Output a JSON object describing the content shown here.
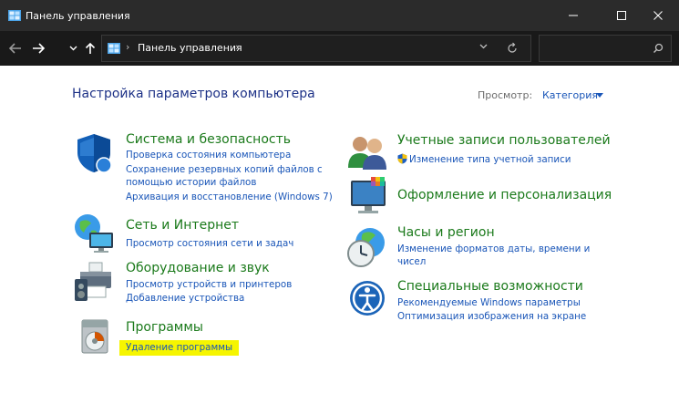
{
  "window": {
    "title": "Панель управления",
    "minimize_glyph": "—",
    "maximize_glyph": "☐",
    "close_glyph": "✕"
  },
  "navbar": {
    "back_glyph": "←",
    "forward_glyph": "→",
    "recent_glyph": "⌄",
    "up_glyph": "↑",
    "breadcrumb_sep": "›",
    "breadcrumb": "Панель управления",
    "dropdown_glyph": "⌄",
    "refresh_glyph": "↻",
    "search_placeholder": "",
    "search_glyph": "⌕"
  },
  "content": {
    "heading": "Настройка параметров компьютера",
    "view_label": "Просмотр:",
    "view_value": "Категория"
  },
  "categories": [
    {
      "icon": "shield-icon",
      "title": "Система и безопасность",
      "links": [
        "Проверка состояния компьютера",
        "Сохранение резервных копий файлов с",
        "помощью истории файлов",
        "Архивация и восстановление (Windows 7)"
      ]
    },
    {
      "icon": "network-globe-icon",
      "title": "Сеть и Интернет",
      "links": [
        "Просмотр состояния сети и задач"
      ]
    },
    {
      "icon": "printer-speaker-icon",
      "title": "Оборудование и звук",
      "links": [
        "Просмотр устройств и принтеров",
        "Добавление устройства"
      ]
    },
    {
      "icon": "programs-disc-icon",
      "title": "Программы",
      "links": [
        "Удаление программы"
      ],
      "highlight_color": "#f6f500"
    },
    {
      "icon": "users-icon",
      "title": "Учетные записи пользователей",
      "links": [
        "Изменение типа учетной записи"
      ]
    },
    {
      "icon": "monitor-palette-icon",
      "title": "Оформление и персонализация",
      "links": []
    },
    {
      "icon": "clock-globe-icon",
      "title": "Часы и регион",
      "links": [
        "Изменение форматов даты, времени и",
        "чисел"
      ]
    },
    {
      "icon": "accessibility-icon",
      "title": "Специальные возможности",
      "links": [
        "Рекомендуемые Windows параметры",
        "Оптимизация изображения на экране"
      ]
    }
  ],
  "colors": {
    "titlebar": "#2b2b2b",
    "navbar": "#191919",
    "heading": "#1e3287",
    "category_title": "#1b7a1b",
    "link": "#1a56b8",
    "highlight": "#f6f500"
  }
}
